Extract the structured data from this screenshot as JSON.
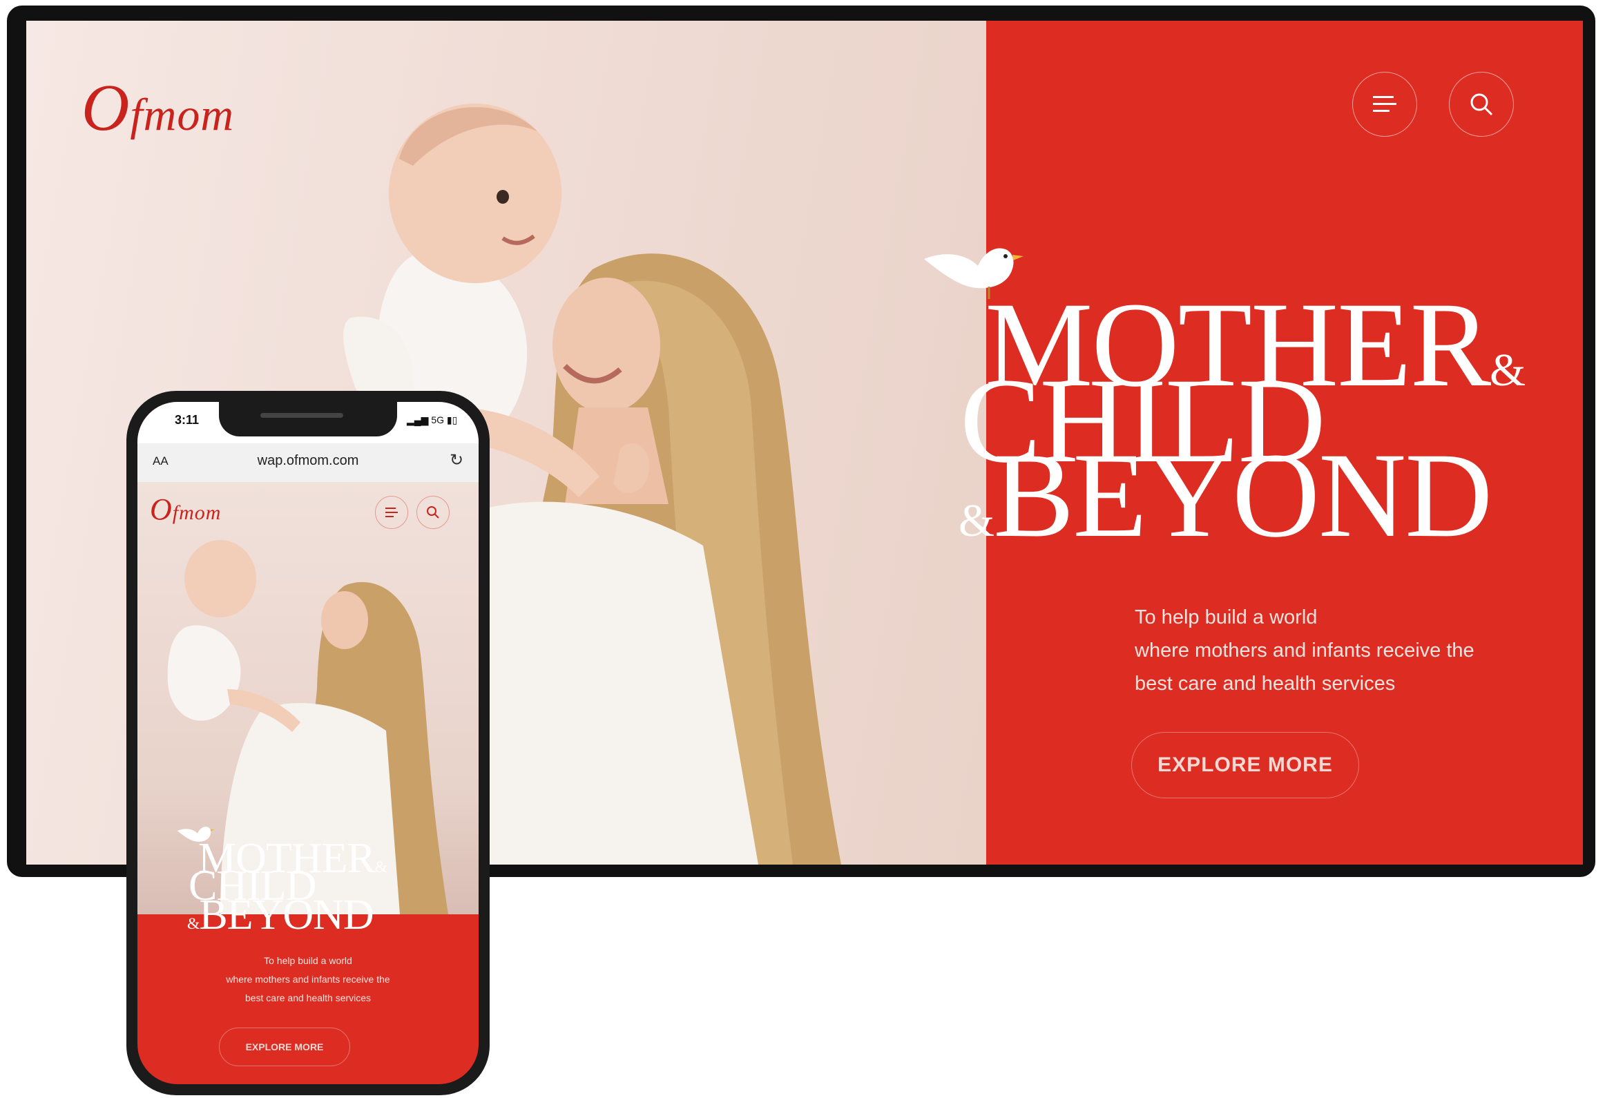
{
  "desktop": {
    "logo": {
      "first": "O",
      "rest": "fmom"
    },
    "menu_icon": "hamburger-menu-icon",
    "search_icon": "search-icon",
    "hero": {
      "line1": "MOTHER",
      "line1_suffix": "&",
      "line2": "CHILD",
      "line3_prefix": "&",
      "line3": "BEYOND"
    },
    "tagline": [
      "To help build a world",
      "where mothers and infants receive the",
      "best care and health services"
    ],
    "cta_label": "EXPLORE MORE"
  },
  "phone": {
    "time": "3:11",
    "signal": "5G",
    "address_text_size": "AA",
    "url": "wap.ofmom.com",
    "reload_icon": "reload-icon",
    "logo": {
      "first": "O",
      "rest": "fmom"
    },
    "hero": {
      "line1": "MOTHER",
      "line1_suffix": "&",
      "line2": "CHILD",
      "line3_prefix": "&",
      "line3": "BEYOND"
    },
    "tagline": [
      "To help build a world",
      "where mothers and infants receive the",
      "best care and health services"
    ],
    "cta_label": "EXPLORE MORE"
  },
  "colors": {
    "brand_red": "#dd2c22",
    "logo_red": "#c8231c",
    "photo_bg": "#f0ddd6"
  }
}
